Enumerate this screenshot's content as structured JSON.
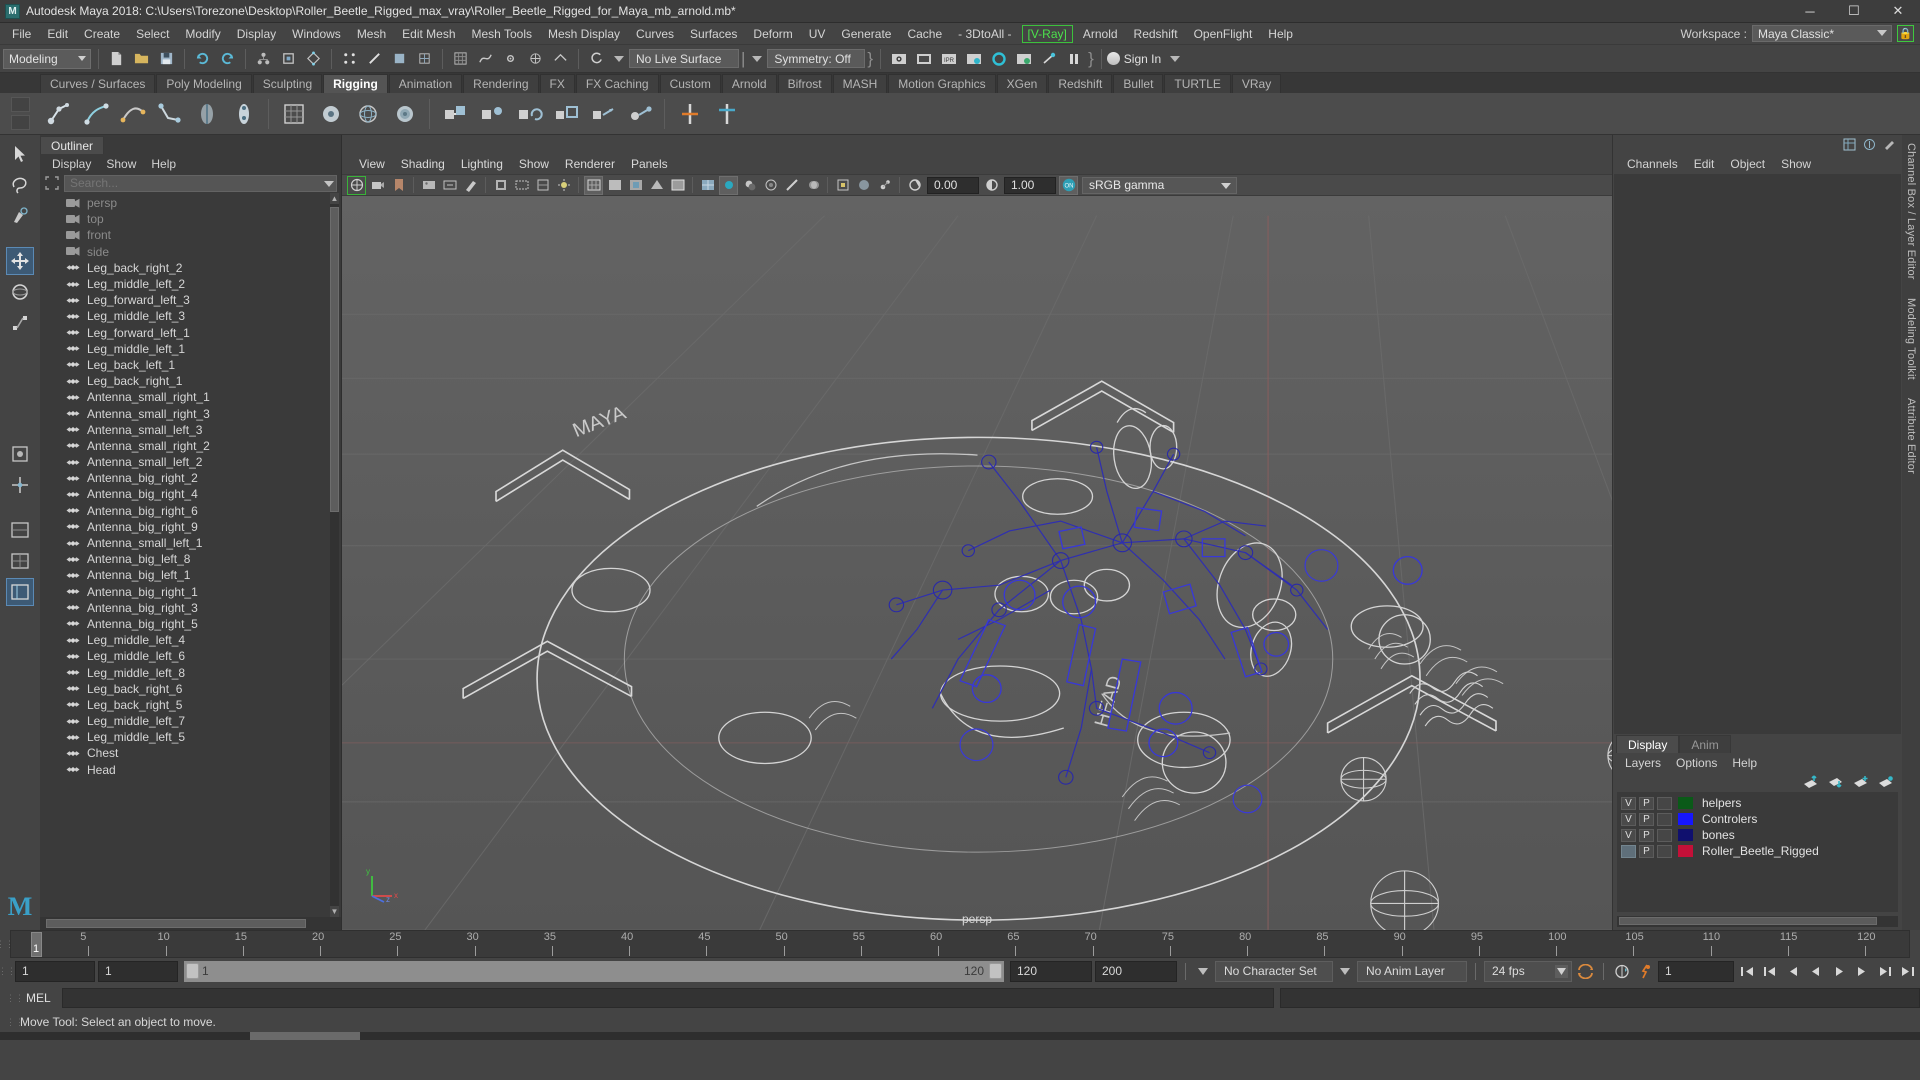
{
  "window": {
    "title": "Autodesk Maya 2018: C:\\Users\\Torezone\\Desktop\\Roller_Beetle_Rigged_max_vray\\Roller_Beetle_Rigged_for_Maya_mb_arnold.mb*",
    "logo_letter": "M",
    "minimize": "─",
    "maximize": "☐",
    "close": "✕"
  },
  "menubar": {
    "items": [
      {
        "label": "File"
      },
      {
        "label": "Edit"
      },
      {
        "label": "Create"
      },
      {
        "label": "Select"
      },
      {
        "label": "Modify"
      },
      {
        "label": "Display"
      },
      {
        "label": "Windows"
      },
      {
        "label": "Mesh"
      },
      {
        "label": "Edit Mesh"
      },
      {
        "label": "Mesh Tools"
      },
      {
        "label": "Mesh Display"
      },
      {
        "label": "Curves"
      },
      {
        "label": "Surfaces"
      },
      {
        "label": "Deform"
      },
      {
        "label": "UV"
      },
      {
        "label": "Generate"
      },
      {
        "label": "Cache"
      },
      {
        "label": "- 3DtoAll -"
      },
      {
        "label": "[V-Ray]",
        "highlight": true
      },
      {
        "label": "Arnold"
      },
      {
        "label": "Redshift"
      },
      {
        "label": "OpenFlight"
      },
      {
        "label": "Help"
      }
    ],
    "workspace_label": "Workspace :",
    "workspace_value": "Maya Classic*",
    "lock_icon": "lock-icon"
  },
  "statusline": {
    "selection_mode": "Modeling",
    "live_surface": "No Live Surface",
    "symmetry": "Symmetry: Off",
    "signin": "Sign In"
  },
  "shelf": {
    "tabs": [
      {
        "label": "Curves / Surfaces"
      },
      {
        "label": "Poly Modeling"
      },
      {
        "label": "Sculpting"
      },
      {
        "label": "Rigging",
        "active": true
      },
      {
        "label": "Animation"
      },
      {
        "label": "Rendering"
      },
      {
        "label": "FX"
      },
      {
        "label": "FX Caching"
      },
      {
        "label": "Custom"
      },
      {
        "label": "Arnold"
      },
      {
        "label": "Bifrost"
      },
      {
        "label": "MASH"
      },
      {
        "label": "Motion Graphics"
      },
      {
        "label": "XGen"
      },
      {
        "label": "Redshift"
      },
      {
        "label": "Bullet"
      },
      {
        "label": "TURTLE"
      },
      {
        "label": "VRay"
      }
    ]
  },
  "outliner": {
    "tab": "Outliner",
    "menus": [
      "Display",
      "Show",
      "Help"
    ],
    "search_placeholder": "Search...",
    "items": [
      {
        "label": "persp",
        "type": "camera"
      },
      {
        "label": "top",
        "type": "camera"
      },
      {
        "label": "front",
        "type": "camera"
      },
      {
        "label": "side",
        "type": "camera"
      },
      {
        "label": "Leg_back_right_2",
        "type": "transform"
      },
      {
        "label": "Leg_middle_left_2",
        "type": "transform"
      },
      {
        "label": "Leg_forward_left_3",
        "type": "transform"
      },
      {
        "label": "Leg_middle_left_3",
        "type": "transform"
      },
      {
        "label": "Leg_forward_left_1",
        "type": "transform"
      },
      {
        "label": "Leg_middle_left_1",
        "type": "transform"
      },
      {
        "label": "Leg_back_left_1",
        "type": "transform"
      },
      {
        "label": "Leg_back_right_1",
        "type": "transform"
      },
      {
        "label": "Antenna_small_right_1",
        "type": "transform"
      },
      {
        "label": "Antenna_small_right_3",
        "type": "transform"
      },
      {
        "label": "Antenna_small_left_3",
        "type": "transform"
      },
      {
        "label": "Antenna_small_right_2",
        "type": "transform"
      },
      {
        "label": "Antenna_small_left_2",
        "type": "transform"
      },
      {
        "label": "Antenna_big_right_2",
        "type": "transform"
      },
      {
        "label": "Antenna_big_right_4",
        "type": "transform"
      },
      {
        "label": "Antenna_big_right_6",
        "type": "transform"
      },
      {
        "label": "Antenna_big_right_9",
        "type": "transform"
      },
      {
        "label": "Antenna_small_left_1",
        "type": "transform"
      },
      {
        "label": "Antenna_big_left_8",
        "type": "transform"
      },
      {
        "label": "Antenna_big_left_1",
        "type": "transform"
      },
      {
        "label": "Antenna_big_right_1",
        "type": "transform"
      },
      {
        "label": "Antenna_big_right_3",
        "type": "transform"
      },
      {
        "label": "Antenna_big_right_5",
        "type": "transform"
      },
      {
        "label": "Leg_middle_left_4",
        "type": "transform"
      },
      {
        "label": "Leg_middle_left_6",
        "type": "transform"
      },
      {
        "label": "Leg_middle_left_8",
        "type": "transform"
      },
      {
        "label": "Leg_back_right_6",
        "type": "transform"
      },
      {
        "label": "Leg_back_right_5",
        "type": "transform"
      },
      {
        "label": "Leg_middle_left_7",
        "type": "transform"
      },
      {
        "label": "Leg_middle_left_5",
        "type": "transform"
      },
      {
        "label": "Chest",
        "type": "transform"
      },
      {
        "label": "Head",
        "type": "transform"
      }
    ]
  },
  "viewport": {
    "menus": [
      "View",
      "Shading",
      "Lighting",
      "Show",
      "Renderer",
      "Panels"
    ],
    "exposure": "0.00",
    "gamma": "1.00",
    "colorspace": "sRGB gamma",
    "camera_label": "persp",
    "axis_x": "x",
    "axis_y": "y",
    "axis_z": "z",
    "scene_text_1": "MAYA",
    "scene_text_2": "HEAD"
  },
  "channelbox": {
    "menus": [
      "Channels",
      "Edit",
      "Object",
      "Show"
    ]
  },
  "layer_editor": {
    "tabs": [
      {
        "label": "Display",
        "active": true
      },
      {
        "label": "Anim",
        "active": false
      }
    ],
    "menus": [
      "Layers",
      "Options",
      "Help"
    ],
    "col_v": "V",
    "col_p": "P",
    "layers": [
      {
        "name": "helpers",
        "color": "#0a5a18",
        "visible": "V",
        "playback": "P"
      },
      {
        "name": "Controlers",
        "color": "#1616ff",
        "visible": "V",
        "playback": "P"
      },
      {
        "name": "bones",
        "color": "#10106e",
        "visible": "V",
        "playback": "P"
      },
      {
        "name": "Roller_Beetle_Rigged",
        "color": "#c41038",
        "visible": "",
        "playback": "P"
      }
    ]
  },
  "sidetabs": [
    {
      "label": "Channel Box / Layer Editor"
    },
    {
      "label": "Modeling Toolkit"
    },
    {
      "label": "Attribute Editor"
    }
  ],
  "timeline": {
    "current_frame": "1",
    "ticks": [
      {
        "v": "5"
      },
      {
        "v": "10"
      },
      {
        "v": "15"
      },
      {
        "v": "20"
      },
      {
        "v": "25"
      },
      {
        "v": "30"
      },
      {
        "v": "35"
      },
      {
        "v": "40"
      },
      {
        "v": "45"
      },
      {
        "v": "50"
      },
      {
        "v": "55"
      },
      {
        "v": "60"
      },
      {
        "v": "65"
      },
      {
        "v": "70"
      },
      {
        "v": "75"
      },
      {
        "v": "80"
      },
      {
        "v": "85"
      },
      {
        "v": "90"
      },
      {
        "v": "95"
      },
      {
        "v": "100"
      },
      {
        "v": "105"
      },
      {
        "v": "110"
      },
      {
        "v": "115"
      },
      {
        "v": "120"
      }
    ],
    "range_start": "1",
    "anim_start": "1",
    "slider_start": "1",
    "slider_end": "120",
    "range_end": "120",
    "anim_end": "200",
    "playback_frame": "1",
    "character_set": "No Character Set",
    "anim_layer": "No Anim Layer",
    "fps": "24 fps"
  },
  "commandline": {
    "language": "MEL",
    "input_value": "",
    "help_text": "Move Tool: Select an object to move."
  }
}
